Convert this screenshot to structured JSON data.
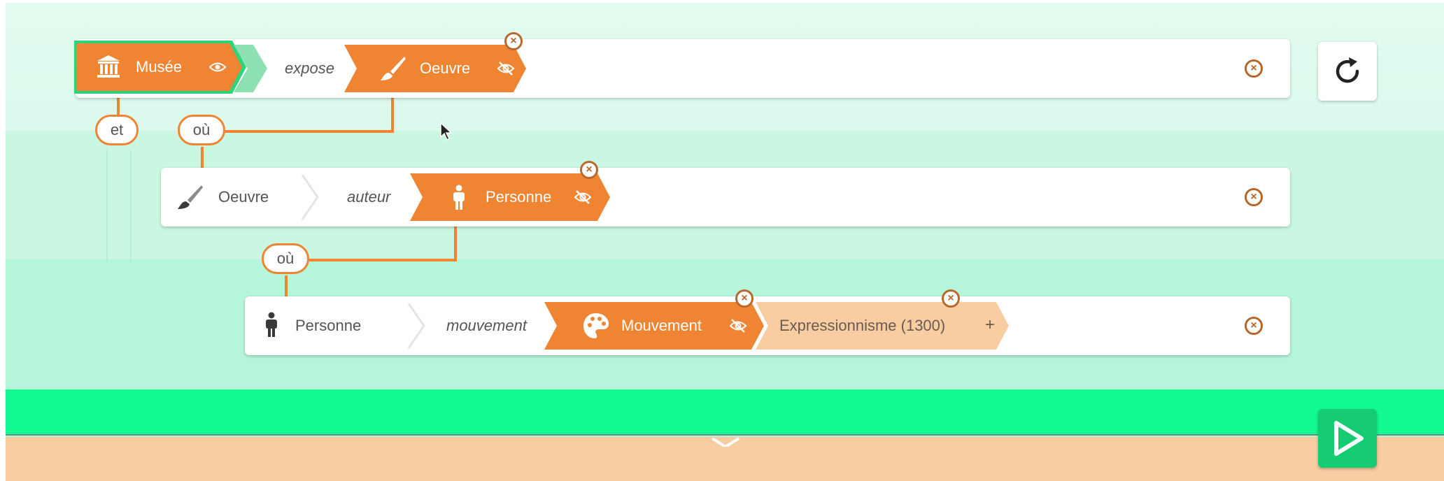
{
  "colors": {
    "accent_orange": "#ef8433",
    "peach": "#f8cda2",
    "green_bar": "#14fa92",
    "play_button": "#16cc72",
    "selected_border": "#2fd37a"
  },
  "rows": [
    {
      "subject": {
        "label": "Musée",
        "icon": "museum-icon",
        "visibility_icon": "eye-icon"
      },
      "predicate": "expose",
      "object": {
        "label": "Oeuvre",
        "icon": "paintbrush-icon",
        "visibility_icon": "eye-slash-icon"
      }
    },
    {
      "subject": {
        "label": "Oeuvre",
        "icon": "paintbrush-icon"
      },
      "predicate": "auteur",
      "object": {
        "label": "Personne",
        "icon": "person-icon",
        "visibility_icon": "eye-slash-icon"
      }
    },
    {
      "subject": {
        "label": "Personne",
        "icon": "person-icon"
      },
      "predicate": "mouvement",
      "object": {
        "label": "Mouvement",
        "icon": "palette-icon",
        "visibility_icon": "eye-slash-icon"
      },
      "value": {
        "label": "Expressionnisme (1300)"
      },
      "add_value_label": "+"
    }
  ],
  "connectors": {
    "and_label": "et",
    "where_label_1": "où",
    "where_label_2": "où"
  },
  "close_glyph": "×",
  "icons": {
    "reset": "refresh-icon",
    "play": "play-icon",
    "expand": "chevron-down-icon",
    "cursor": "mouse-pointer-icon"
  }
}
